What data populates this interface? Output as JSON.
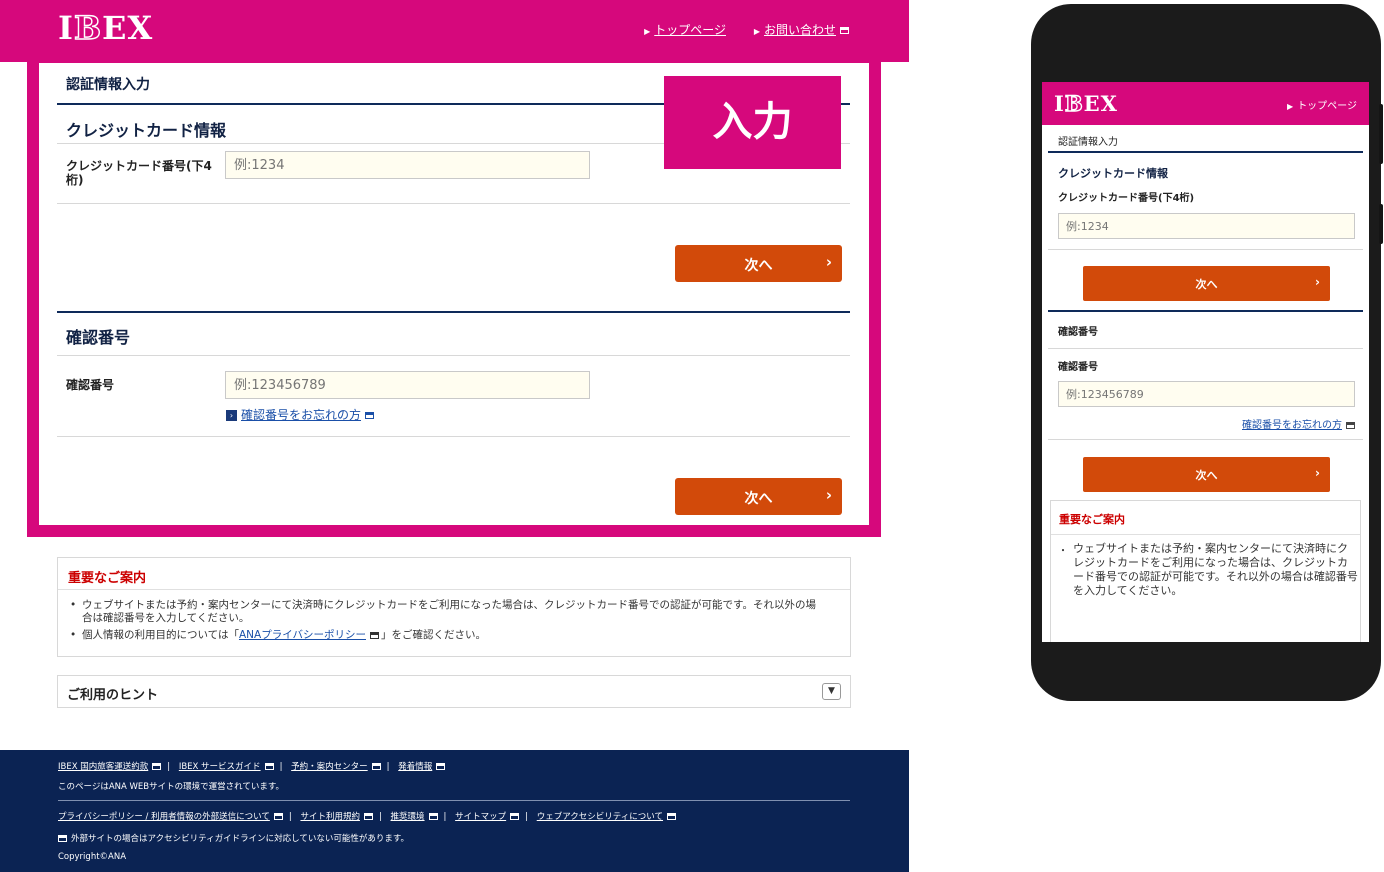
{
  "colors": {
    "brand": "#d6087c",
    "navy": "#0b2353",
    "button": "#d24a0a",
    "notice_heading": "#cc0000",
    "link": "#1a4fa8"
  },
  "logo": {
    "part1": "I",
    "part2": "B",
    "part3": "EX"
  },
  "desktop": {
    "header": {
      "link_top": "トップページ",
      "link_contact": "お問い合わせ"
    },
    "page_title": "認証情報入力",
    "badge": "入力",
    "credit": {
      "title": "クレジットカード情報",
      "label_line1": "クレジットカード番号(下4",
      "label_line2": "桁)",
      "placeholder": "例:1234",
      "next": "次へ"
    },
    "confirm": {
      "title": "確認番号",
      "label": "確認番号",
      "placeholder": "例:123456789",
      "forgot": "確認番号をお忘れの方",
      "next": "次へ"
    },
    "notice": {
      "heading": "重要なご案内",
      "item1_line1": "ウェブサイトまたは予約・案内センターにて決済時にクレジットカードをご利用になった場合は、クレジットカード番号での認証が可能です。それ以外の場",
      "item1_line2": "合は確認番号を入力してください。",
      "item2_pre": "個人情報の利用目的については「",
      "item2_link": "ANAプライバシーポリシー",
      "item2_post": "」をご確認ください。"
    },
    "hint": {
      "title": "ご利用のヒント"
    },
    "footer": {
      "links1": [
        "IBEX 国内旅客運送約款",
        "IBEX サービスガイド",
        "予約・案内センター",
        "発着情報"
      ],
      "operated": "このページはANA WEBサイトの環境で運営されています。",
      "links2": [
        "プライバシーポリシー / 利用者情報の外部送信について",
        "サイト利用規約",
        "推奨環境",
        "サイトマップ",
        "ウェブアクセシビリティについて"
      ],
      "external_note": "外部サイトの場合はアクセシビリティガイドラインに対応していない可能性があります。",
      "copyright": "Copyright©ANA"
    }
  },
  "mobile": {
    "header": {
      "link_top": "トップページ"
    },
    "page_title": "認証情報入力",
    "credit_title": "クレジットカード情報",
    "credit_label": "クレジットカード番号(下4桁)",
    "credit_placeholder": "例:1234",
    "next1": "次へ",
    "confirm_title": "確認番号",
    "confirm_label": "確認番号",
    "confirm_placeholder": "例:123456789",
    "forgot": "確認番号をお忘れの方",
    "next2": "次へ",
    "notice_heading": "重要なご案内",
    "notice_bullet": "・",
    "notice_body": "ウェブサイトまたは予約・案内センターにて決済時にクレジットカードをご利用になった場合は、クレジットカード番号での認証が可能です。それ以外の場合は確認番号を入力してください。"
  }
}
